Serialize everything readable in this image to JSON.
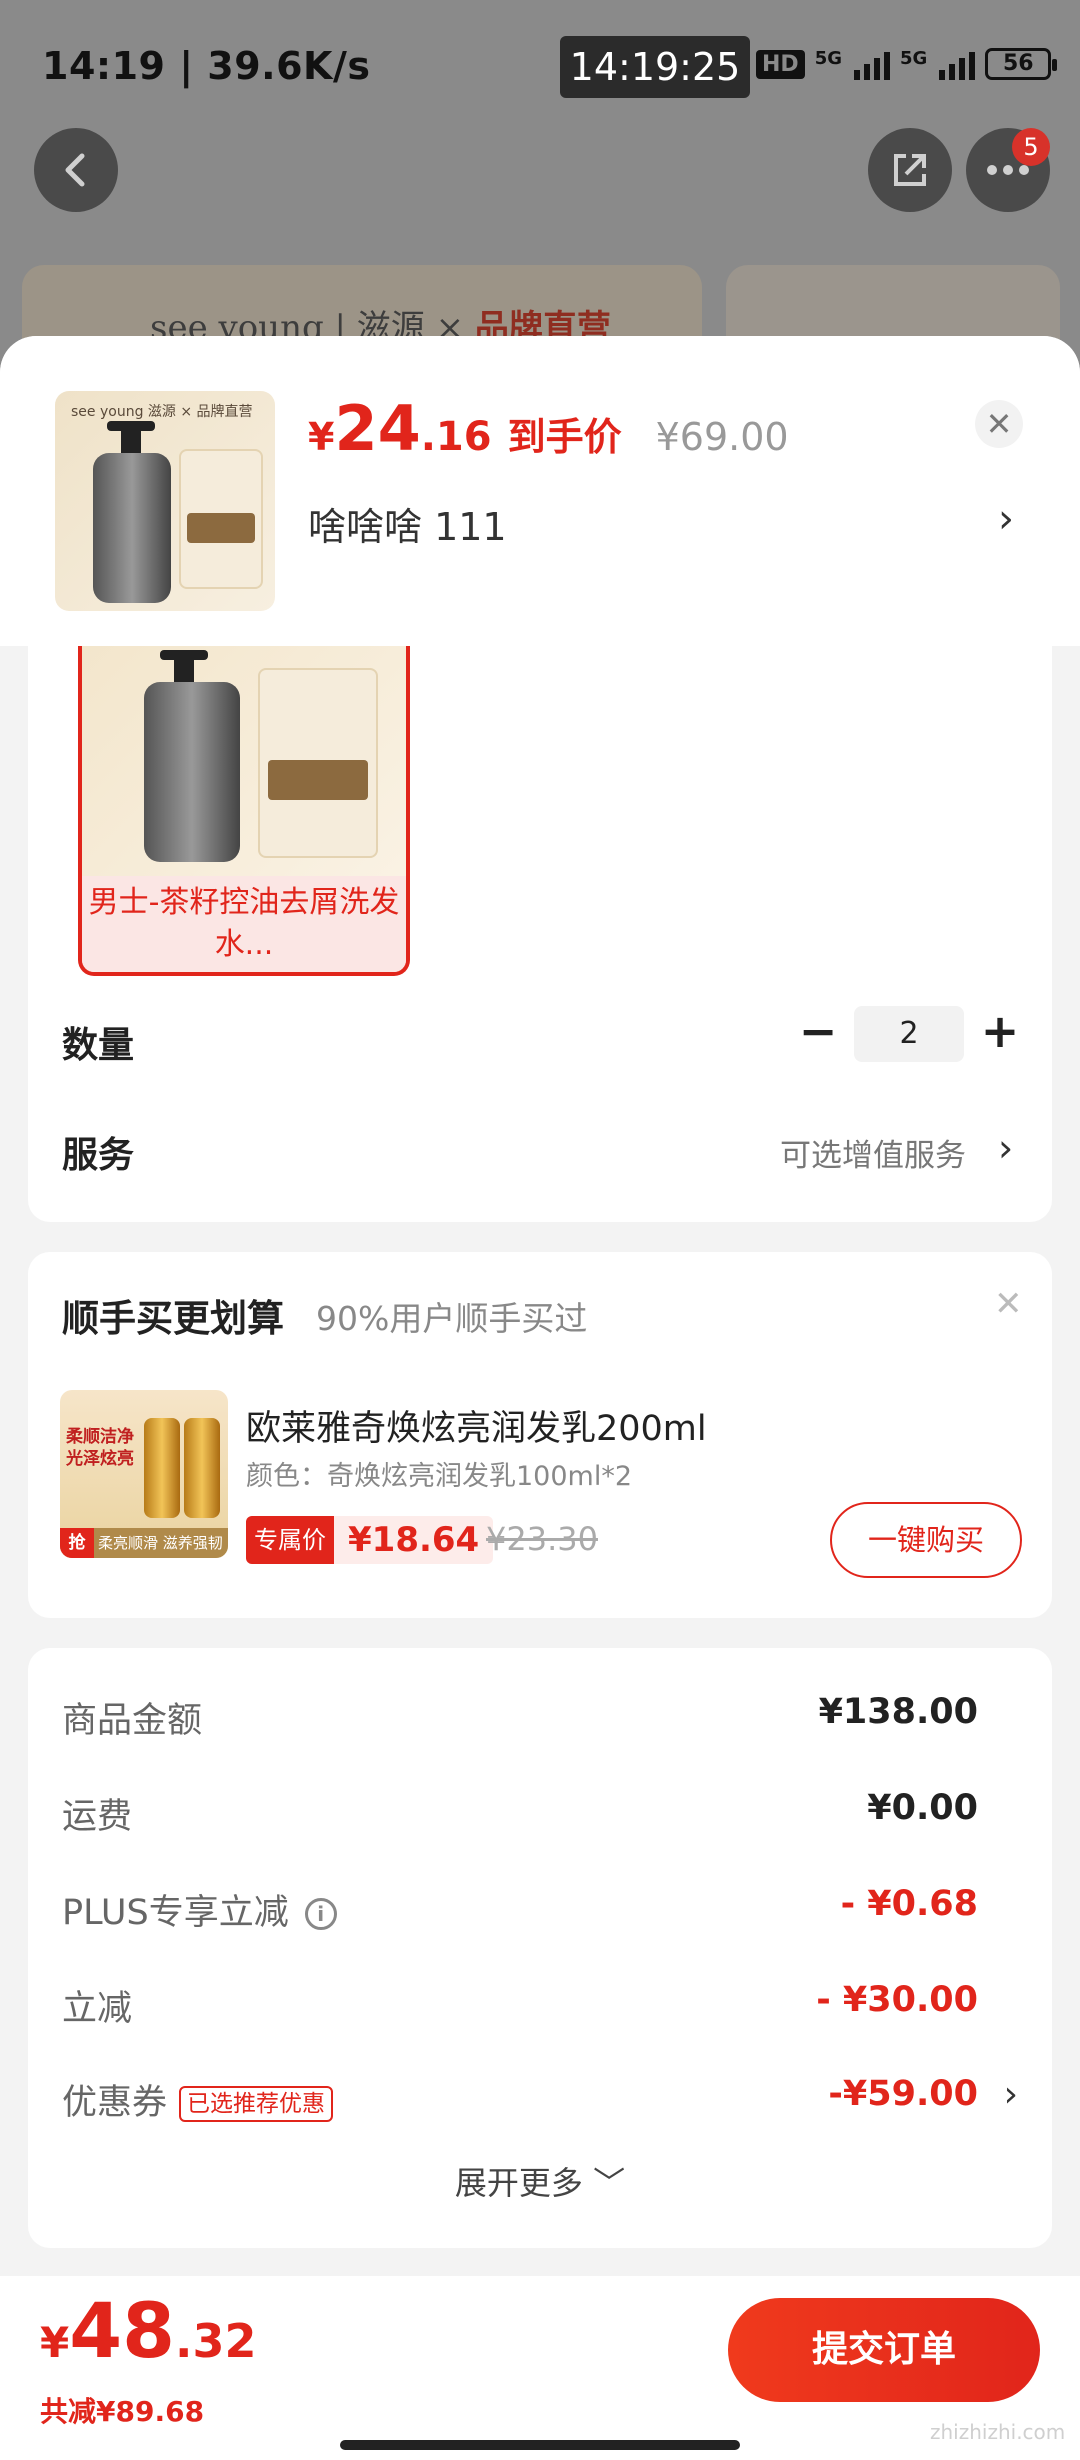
{
  "status_bar": {
    "left_text": "14:19 | 39.6K/s",
    "center_time": "14:19:25",
    "hd": "HD",
    "net1": "5G",
    "net2": "5G",
    "battery": "56"
  },
  "background_page": {
    "notification_count": "5",
    "banner_brand": "see young | 滋源 × ",
    "banner_highlight": "品牌直营"
  },
  "sheet_header": {
    "thumb_tag": "see young 滋源 × 品牌直营",
    "price_symbol": "¥",
    "price_int": "24",
    "price_dec": ".16",
    "price_label": "到手价",
    "original_price": "¥69.00",
    "close_icon": "✕",
    "selected_spec": "啥啥啥  111"
  },
  "spec": {
    "variant_label": "男士-茶籽控油去屑洗发水...",
    "quantity_label": "数量",
    "quantity_value": "2",
    "minus": "−",
    "plus": "+",
    "service_label": "服务",
    "service_value": "可选增值服务"
  },
  "upsell": {
    "title": "顺手买更划算",
    "subtitle": "90%用户顺手买过",
    "product_name": "欧莱雅奇焕炫亮润发乳200ml",
    "product_attr": "颜色：奇焕炫亮润发乳100ml*2",
    "thumb_text": "柔顺洁净 光泽炫亮",
    "thumb_badge": "柔亮顺滑 滋养强韧",
    "thumb_qiang": "抢",
    "price_tag": "专属价",
    "price": "¥18.64",
    "original_price": "¥23.30",
    "buy_button": "一键购买"
  },
  "summary": {
    "rows": [
      {
        "label": "商品金额",
        "value": "¥138.00"
      },
      {
        "label": "运费",
        "value": "¥0.00"
      },
      {
        "label": "PLUS专享立减",
        "value": "- ¥0.68"
      },
      {
        "label": "立减",
        "value": "- ¥30.00"
      },
      {
        "label": "优惠券",
        "value": "-¥59.00",
        "tag": "已选推荐优惠"
      }
    ],
    "expand_more": "展开更多 ﹀"
  },
  "footer": {
    "total_symbol": "¥",
    "total_int": "48",
    "total_dec": ".32",
    "total_saved": "共减¥89.68",
    "submit": "提交订单",
    "watermark": "zhizhizhi.com"
  },
  "colors": {
    "accent": "#e1251b",
    "muted": "#888888"
  }
}
